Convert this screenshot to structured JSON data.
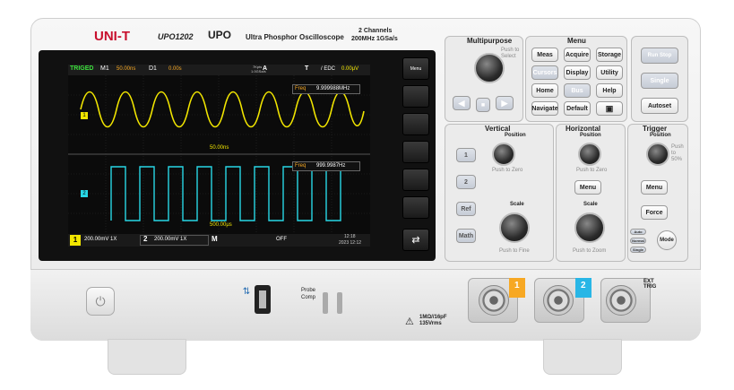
{
  "brand": {
    "logo": "UNI-T",
    "model": "UPO1202",
    "series_logo": "UPO",
    "title": "Ultra Phosphor Oscilloscope",
    "channels": "2 Channels",
    "spec": "200MHz  1GSa/s"
  },
  "screen": {
    "status": {
      "trig": "TRIGED",
      "m_label": "M1",
      "m_value": "50.00ns",
      "d_label": "D1",
      "d_value": "0.00s",
      "acq": "7Kpts",
      "rate": "1.0GSa/s",
      "mode": "A",
      "t_label": "T",
      "coupling": "/ EDC",
      "level": "0.00μV"
    },
    "freq1": {
      "label": "Freq",
      "value": "9.999988MHz"
    },
    "freq2": {
      "label": "Freq",
      "value": "999.9987Hz"
    },
    "timebase1": "50.00ns",
    "timebase2": "500.00μs",
    "bottom": {
      "ch1_num": "1",
      "ch1": "200.00mV 1X",
      "ch2_num": "2",
      "ch2": "200.00mV 1X",
      "m": "M",
      "m_state": "OFF",
      "time": "12:18",
      "date": "2023 12:12"
    }
  },
  "soft_menu": "Menu",
  "multipurpose": {
    "title": "Multipurpose",
    "push": "Push to Select"
  },
  "menu": {
    "title": "Menu",
    "buttons": [
      "Meas",
      "Acquire",
      "Storage",
      "Cursors",
      "Display",
      "Utility",
      "Home",
      "Bus",
      "Help",
      "Navigate",
      "Default",
      ""
    ]
  },
  "run": {
    "run_stop": "Run Stop",
    "single": "Single",
    "autoset": "Autoset"
  },
  "vertical": {
    "title": "Vertical",
    "position": "Position",
    "push_zero": "Push to Zero",
    "ch1": "1",
    "ch2": "2",
    "ref": "Ref",
    "math": "Math",
    "scale": "Scale",
    "push_fine": "Push to Fine"
  },
  "horizontal": {
    "title": "Horizontal",
    "position": "Position",
    "push_zero": "Push to Zero",
    "menu": "Menu",
    "scale": "Scale",
    "push_zoom": "Push to Zoom"
  },
  "trigger": {
    "title": "Trigger",
    "position": "Position",
    "push": "Push to 50%",
    "menu": "Menu",
    "force": "Force",
    "modes": [
      "Auto",
      "Normal",
      "Single"
    ],
    "mode": "Mode"
  },
  "front": {
    "probe_comp": "Probe Comp",
    "ch1": "1",
    "ch2": "2",
    "ext": "EXT TRIG",
    "warning": "1MΩ//16pF 135Vrms"
  },
  "colors": {
    "ch1": "#f2e600",
    "ch2": "#28d7e6",
    "accent": "#f7a823",
    "brand": "#c8102e"
  }
}
